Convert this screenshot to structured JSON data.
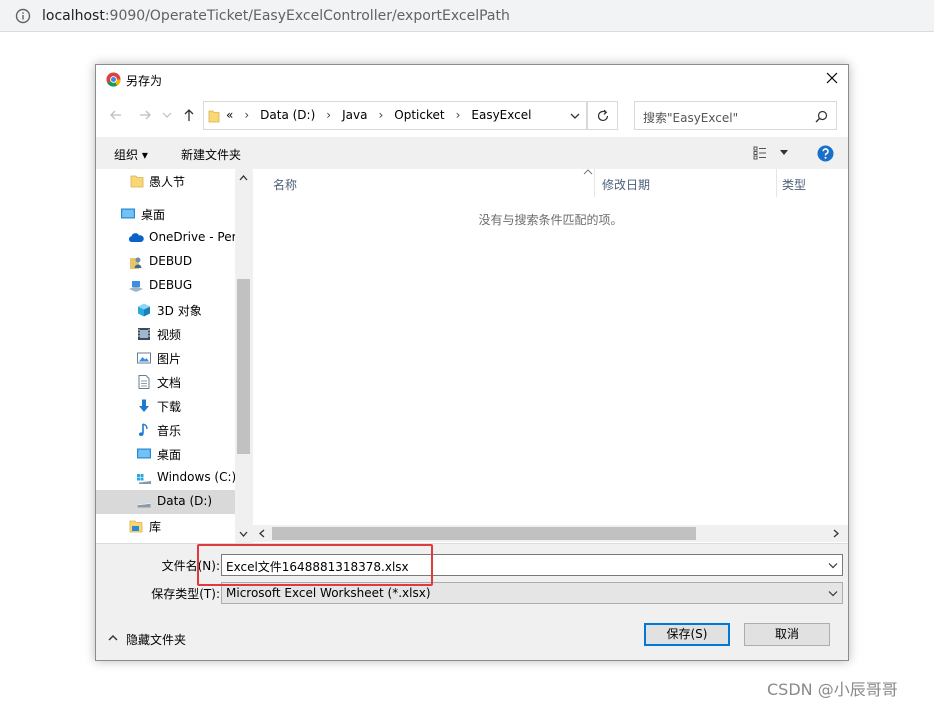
{
  "browser": {
    "url_host": "localhost",
    "url_rest": ":9090/OperateTicket/EasyExcelController/exportExcelPath"
  },
  "dialog": {
    "title": "另存为",
    "breadcrumbs": [
      "«",
      "Data (D:)",
      "Java",
      "Opticket",
      "EasyExcel"
    ],
    "search_placeholder": "搜索\"EasyExcel\"",
    "organize_label": "组织 ▾",
    "new_folder_label": "新建文件夹",
    "nav_items": [
      {
        "label": "愚人节",
        "icon": "folder-icon"
      },
      {
        "label": "桌面",
        "icon": "desktop-icon"
      },
      {
        "label": "OneDrive - Per",
        "icon": "onedrive-icon"
      },
      {
        "label": "DEBUD",
        "icon": "user-icon"
      },
      {
        "label": "DEBUG",
        "icon": "computer-icon"
      },
      {
        "label": "3D 对象",
        "icon": "cube-icon"
      },
      {
        "label": "视频",
        "icon": "video-icon"
      },
      {
        "label": "图片",
        "icon": "picture-icon"
      },
      {
        "label": "文档",
        "icon": "document-icon"
      },
      {
        "label": "下载",
        "icon": "download-icon"
      },
      {
        "label": "音乐",
        "icon": "music-icon"
      },
      {
        "label": "桌面",
        "icon": "desktop-icon"
      },
      {
        "label": "Windows (C:)",
        "icon": "drive-icon"
      },
      {
        "label": "Data (D:)",
        "icon": "drive-icon"
      },
      {
        "label": "库",
        "icon": "library-icon"
      }
    ],
    "columns": [
      "名称",
      "修改日期",
      "类型"
    ],
    "empty_message": "没有与搜索条件匹配的项。",
    "filename_label": "文件名(N):",
    "filename_value": "Excel文件1648881318378.xlsx",
    "filetype_label": "保存类型(T):",
    "filetype_value": "Microsoft Excel Worksheet (*.xlsx)",
    "hide_folders_label": "隐藏文件夹",
    "save_button": "保存(S)",
    "cancel_button": "取消"
  },
  "watermark": "CSDN @小辰哥哥",
  "colors": {
    "accent": "#0078d7",
    "highlight": "#e0393e",
    "selected_row": "#d9d9d9",
    "column_header": "#4c607a"
  }
}
